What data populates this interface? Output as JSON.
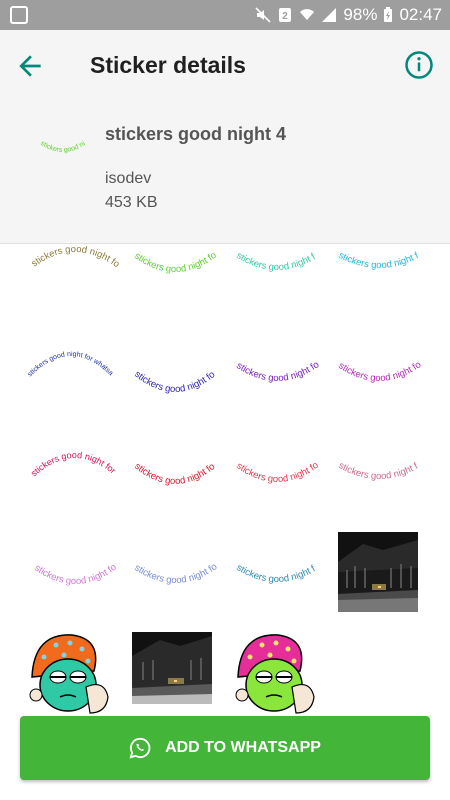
{
  "status_bar": {
    "battery": "98%",
    "time": "02:47"
  },
  "app_bar": {
    "title": "Sticker details",
    "back_icon": "arrow-back-icon",
    "info_icon": "info-icon"
  },
  "pack": {
    "name": "stickers good night 4",
    "publisher": "isodev",
    "size": "453 KB",
    "tray_text": "stickers good night"
  },
  "sticker_text": "stickers good night for whatsapp",
  "sticker_colors": [
    "#8a7a3a",
    "#5fd12f",
    "#2fc9a6",
    "#22b8d8",
    "#1c2fae",
    "#2a1fb0",
    "#7a1fb8",
    "#b02ab6",
    "#d4145a",
    "#d11a2a",
    "#e03a55",
    "#c76b8a",
    "#d27ad8",
    "#7a8ad6",
    "#2a8ab0"
  ],
  "cta": {
    "label": "ADD TO WHATSAPP",
    "icon": "whatsapp-icon"
  },
  "colors": {
    "accent": "#00897b",
    "button": "#43b63a"
  }
}
